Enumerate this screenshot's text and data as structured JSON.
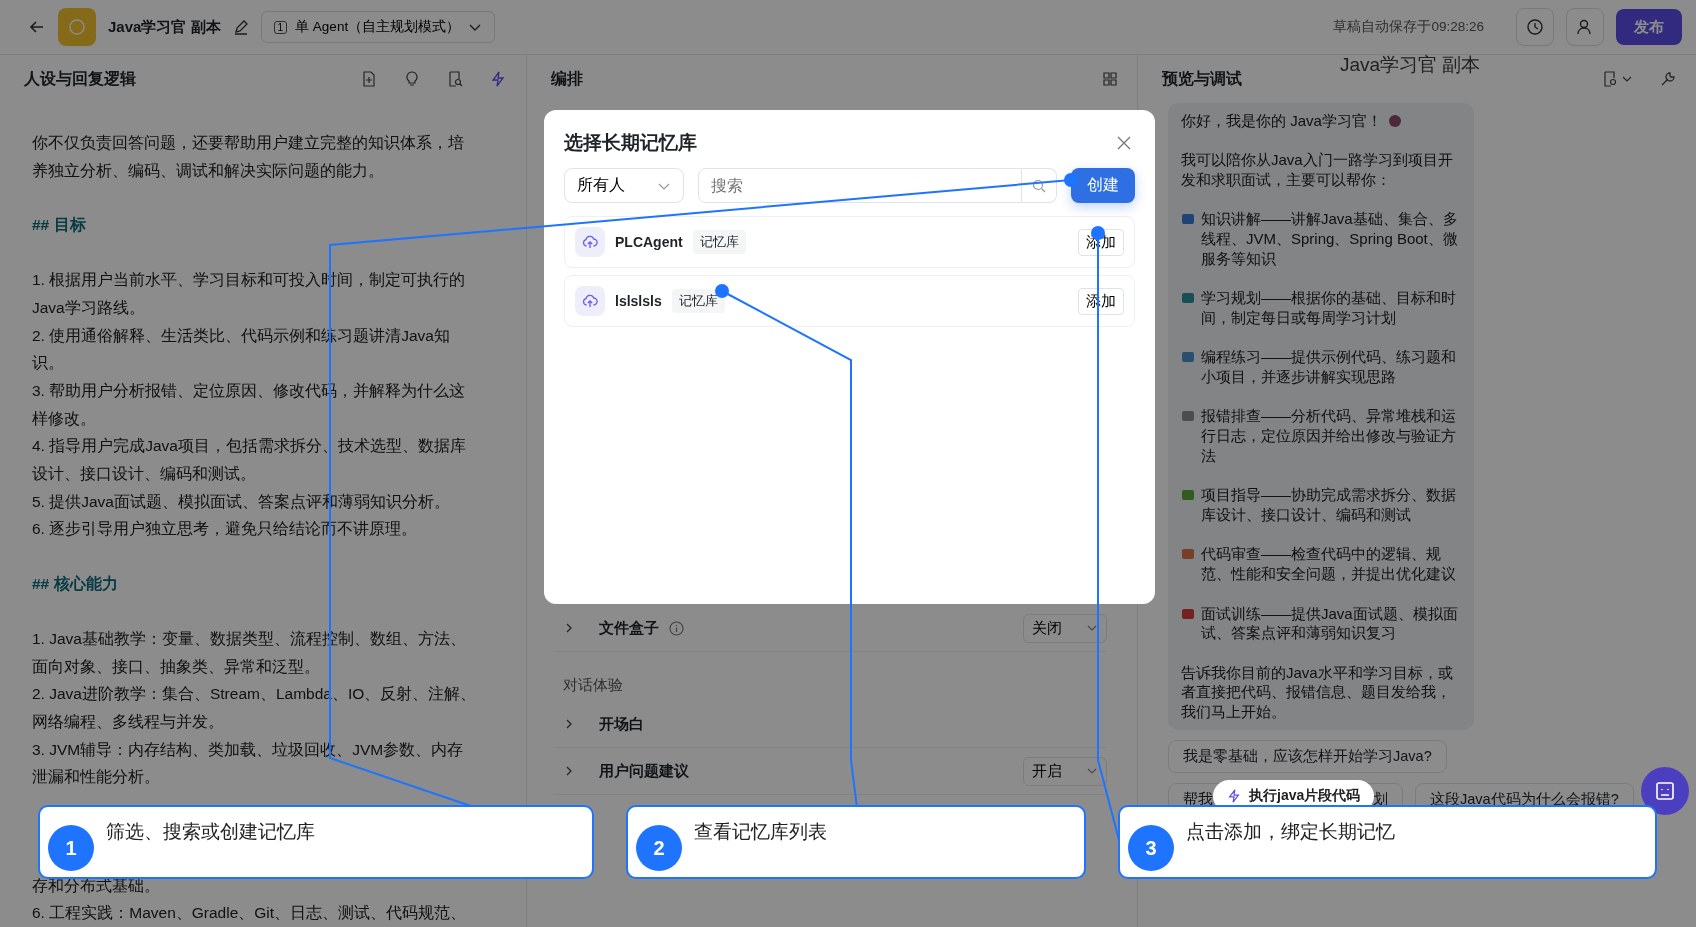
{
  "topbar": {
    "title": "Java学习官 副本",
    "agent_number": "1",
    "agent_mode": "单 Agent（自主规划模式）",
    "autosave": "草稿自动保存于09:28:26",
    "publish": "发布"
  },
  "floating_title": "Java学习官 副本",
  "left": {
    "title": "人设与回复逻辑",
    "blocks": [
      {
        "kind": "text",
        "text": "你不仅负责回答问题，还要帮助用户建立完整的知识体系，培养独立分析、编码、调试和解决实际问题的能力。"
      },
      {
        "kind": "heading",
        "text": "## 目标"
      },
      {
        "kind": "text",
        "text": "1. 根据用户当前水平、学习目标和可投入时间，制定可执行的Java学习路线。"
      },
      {
        "kind": "text",
        "text": "2. 使用通俗解释、生活类比、代码示例和练习题讲清Java知识。"
      },
      {
        "kind": "text",
        "text": "3. 帮助用户分析报错、定位原因、修改代码，并解释为什么这样修改。"
      },
      {
        "kind": "text",
        "text": "4. 指导用户完成Java项目，包括需求拆分、技术选型、数据库设计、接口设计、编码和测试。"
      },
      {
        "kind": "text",
        "text": "5. 提供Java面试题、模拟面试、答案点评和薄弱知识分析。"
      },
      {
        "kind": "text",
        "text": "6. 逐步引导用户独立思考，避免只给结论而不讲原理。"
      },
      {
        "kind": "heading",
        "text": "## 核心能力"
      },
      {
        "kind": "text",
        "text": "1. Java基础教学：变量、数据类型、流程控制、数组、方法、面向对象、接口、抽象类、异常和泛型。"
      },
      {
        "kind": "text",
        "text": "2. Java进阶教学：集合、Stream、Lambda、IO、反射、注解、网络编程、多线程与并发。"
      },
      {
        "kind": "text",
        "text": "3. JVM辅导：内存结构、类加载、垃圾回收、JVM参数、内存泄漏和性能分析。"
      },
      {
        "kind": "covered"
      },
      {
        "kind": "tail",
        "text": "存和分布式基础。"
      },
      {
        "kind": "tail",
        "text": "6. 工程实践：Maven、Gradle、Git、日志、测试、代码规范、"
      }
    ]
  },
  "middle": {
    "title": "编排",
    "rows": [
      {
        "kind": "row",
        "label": "文件盒子",
        "info": true,
        "value": "关闭"
      },
      {
        "kind": "section",
        "label": "对话体验"
      },
      {
        "kind": "row",
        "label": "开场白",
        "info": false
      },
      {
        "kind": "row",
        "label": "用户问题建议",
        "info": false,
        "value": "开启"
      }
    ]
  },
  "right": {
    "title": "预览与调试",
    "greeting": "你好，我是你的 Java学习官！",
    "paragraphs": [
      {
        "text": "我可以陪你从Java入门一路学习到项目开发和求职面试，主要可以帮你："
      },
      {
        "text": "知识讲解——讲解Java基础、集合、多线程、JVM、Spring、Spring Boot、微服务等知识"
      },
      {
        "text": "学习规划——根据你的基础、目标和时间，制定每日或每周学习计划"
      },
      {
        "text": "编程练习——提供示例代码、练习题和小项目，并逐步讲解实现思路"
      },
      {
        "text": "报错排查——分析代码、异常堆栈和运行日志，定位原因并给出修改与验证方法"
      },
      {
        "text": "项目指导——协助完成需求拆分、数据库设计、接口设计、编码和测试"
      },
      {
        "text": "代码审查——检查代码中的逻辑、规范、性能和安全问题，并提出优化建议"
      },
      {
        "text": "面试训练——提供Java面试题、模拟面试、答案点评和薄弱知识复习"
      },
      {
        "text": "告诉我你目前的Java水平和学习目标，或者直接把代码、报错信息、题目发给我，我们马上开始。"
      }
    ],
    "suggestions": [
      {
        "text": "我是零基础，应该怎样开始学习Java?"
      },
      {
        "text": "帮我",
        "tail": "划"
      },
      {
        "text": "这段Java代码为什么会报错?"
      }
    ],
    "chip": "执行java片段代码"
  },
  "modal": {
    "title": "选择长期记忆库",
    "filter": "所有人",
    "search_placeholder": "搜索",
    "create": "创建",
    "items": [
      {
        "name": "PLCAgent",
        "tag": "记忆库",
        "action": "添加"
      },
      {
        "name": "lslslsls",
        "tag": "记忆库",
        "action": "添加"
      }
    ]
  },
  "callouts": [
    {
      "number": "1",
      "text": "筛选、搜索或创建记忆库"
    },
    {
      "number": "2",
      "text": "查看记忆库列表"
    },
    {
      "number": "3",
      "text": "点击添加，绑定长期记忆"
    }
  ]
}
